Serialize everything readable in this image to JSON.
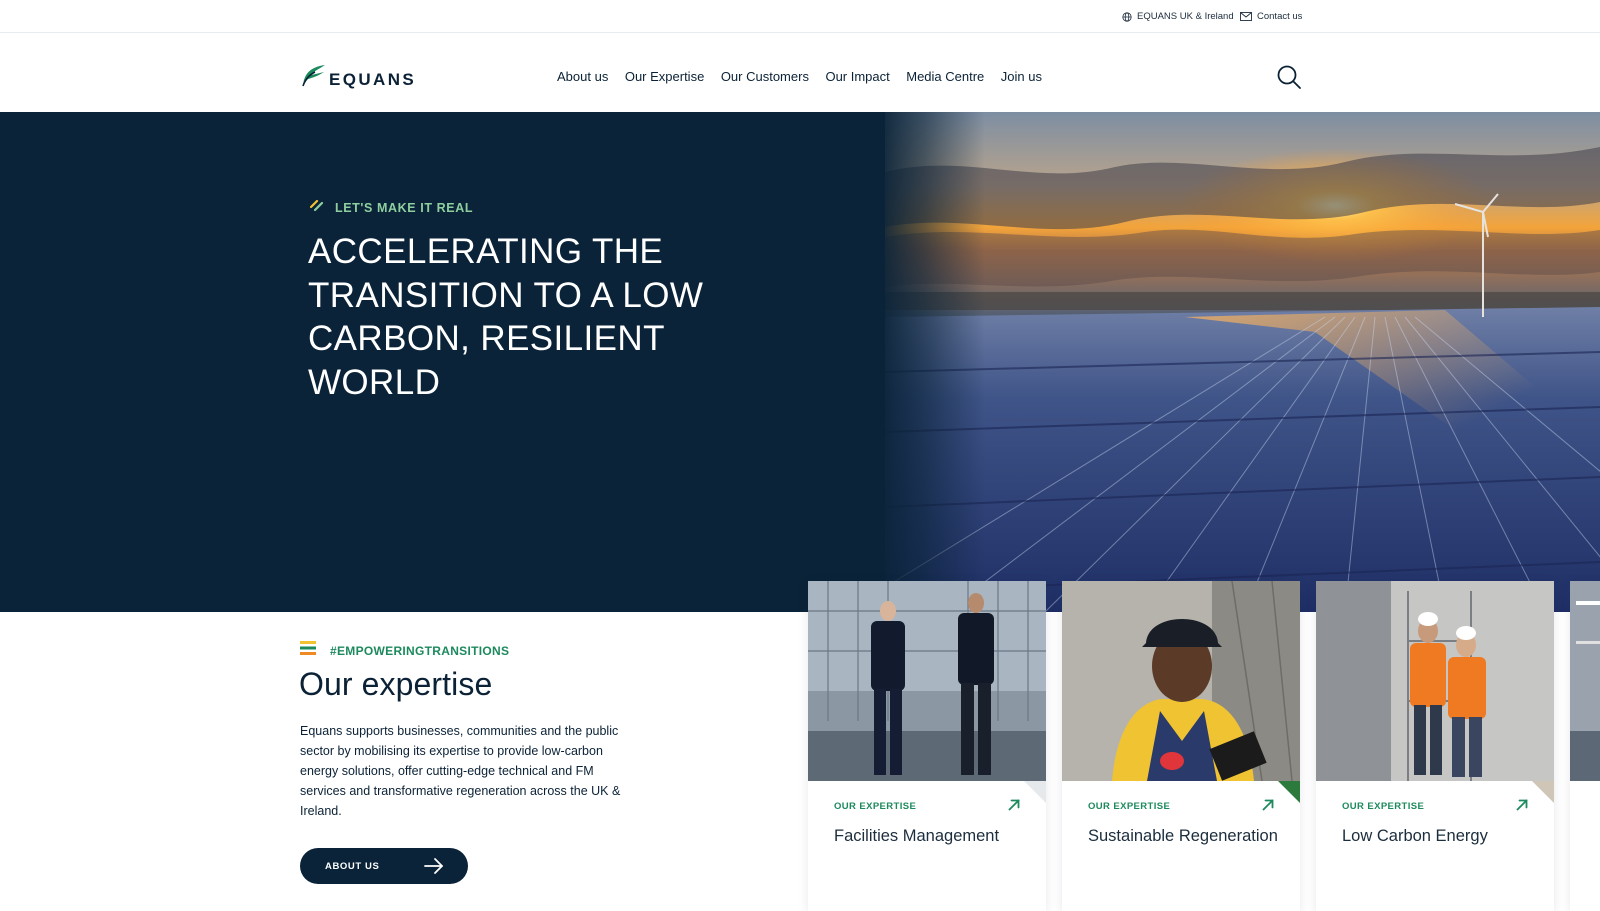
{
  "utility_bar": {
    "region_label": "EQUANS UK & Ireland",
    "contact_label": "Contact us"
  },
  "header": {
    "logo_text": "EQUANS",
    "nav": [
      {
        "label": "About us"
      },
      {
        "label": "Our Expertise"
      },
      {
        "label": "Our Customers"
      },
      {
        "label": "Our Impact"
      },
      {
        "label": "Media Centre"
      },
      {
        "label": "Join us"
      }
    ],
    "search_icon": "search-icon"
  },
  "hero": {
    "eyebrow": "LET'S MAKE IT REAL",
    "title": "ACCELERATING THE TRANSITION TO A LOW CARBON, RESILIENT WORLD",
    "background": "#0a2338",
    "image": "solar panels with wind turbine at sunset"
  },
  "expertise": {
    "hashtag": "#EMPOWERINGTRANSITIONS",
    "title": "Our expertise",
    "body": "Equans supports businesses, communities and the public sector by mobilising its expertise to provide low-carbon energy solutions, offer cutting-edge technical and FM services and transformative regeneration across the UK & Ireland.",
    "button_label": "ABOUT US"
  },
  "cards": [
    {
      "kicker": "OUR EXPERTISE",
      "title": "Facilities Management",
      "corner_color": "#e6e9ec"
    },
    {
      "kicker": "OUR EXPERTISE",
      "title": "Sustainable Regeneration",
      "corner_color": "#2c7a3c"
    },
    {
      "kicker": "OUR EXPERTISE",
      "title": "Low Carbon Energy",
      "corner_color": "#cfc6b8"
    }
  ],
  "colors": {
    "navy": "#0a2338",
    "green": "#1d8a5e",
    "mint": "#8fcf9f",
    "yellow": "#f2c230",
    "orange": "#f08a24"
  }
}
